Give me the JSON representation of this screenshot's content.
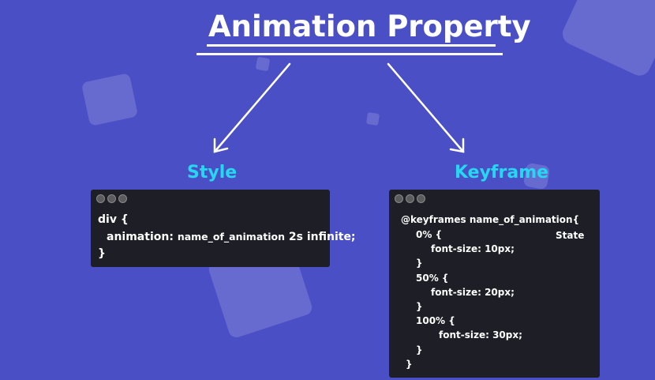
{
  "title": "Animation Property",
  "headings": {
    "style": "Style",
    "keyframe": "Keyframe"
  },
  "style_code": {
    "open": "div {",
    "prop": "animation:",
    "value_name": "name_of_animation",
    "value_rest": "2s infinite;",
    "close": "}"
  },
  "keyframe_code": {
    "line1": "@keyframes name_of_animation{",
    "state_label": "State",
    "l0_sel": "0% {",
    "l0_decl": "font-size: 10px;",
    "l0_close": "}",
    "l1_sel": "50% {",
    "l1_decl": "font-size: 20px;",
    "l1_close": "}",
    "l2_sel": "100% {",
    "l2_decl": "font-size: 30px;",
    "l2_close": "}",
    "end": "}"
  },
  "colors": {
    "background": "#4b4fc6",
    "heading": "#26d7f0",
    "code_bg": "#1e1f26"
  }
}
